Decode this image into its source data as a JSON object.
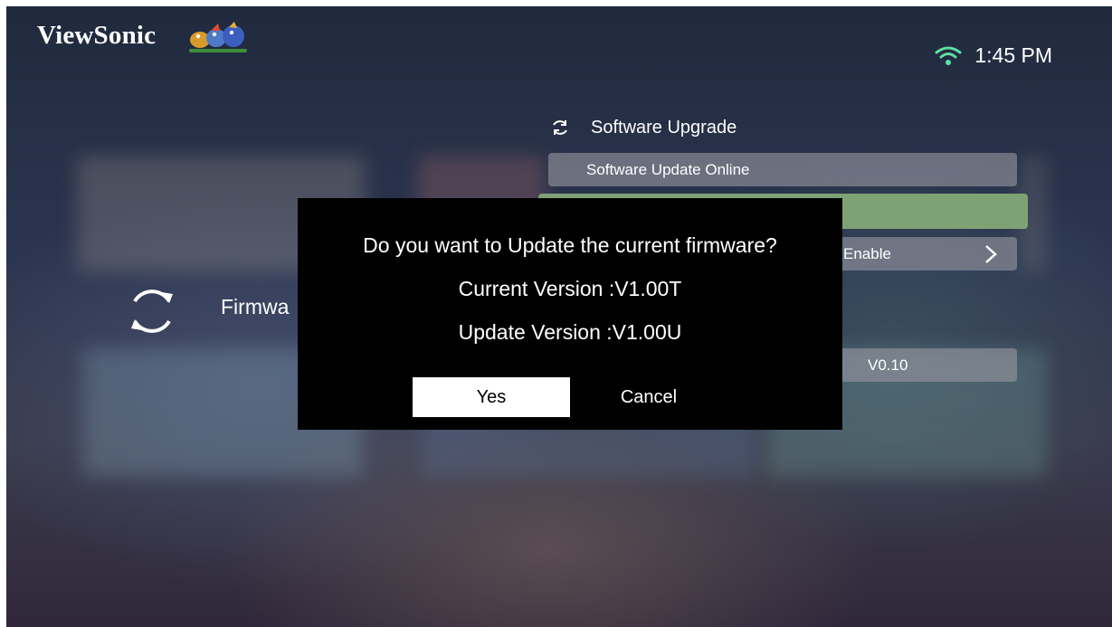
{
  "brand": {
    "name": "ViewSonic"
  },
  "status_bar": {
    "time": "1:45 PM",
    "wifi_icon": "wifi-icon"
  },
  "section": {
    "title": "Software Upgrade",
    "icon": "refresh-icon",
    "items": [
      {
        "label": "Software Update Online"
      },
      {
        "label": ""
      },
      {
        "label": "Enable"
      },
      {
        "label": "V0.10"
      }
    ]
  },
  "sidebar": {
    "label": "Firmwa",
    "icon": "refresh-icon"
  },
  "dialog": {
    "question": "Do you want to Update the current firmware?",
    "current_version": "Current Version :V1.00T",
    "update_version": "Update Version :V1.00U",
    "yes_label": "Yes",
    "cancel_label": "Cancel"
  },
  "colors": {
    "selected_item": "#7ea273",
    "dialog_bg": "#000000",
    "yes_button_bg": "#ffffff"
  }
}
